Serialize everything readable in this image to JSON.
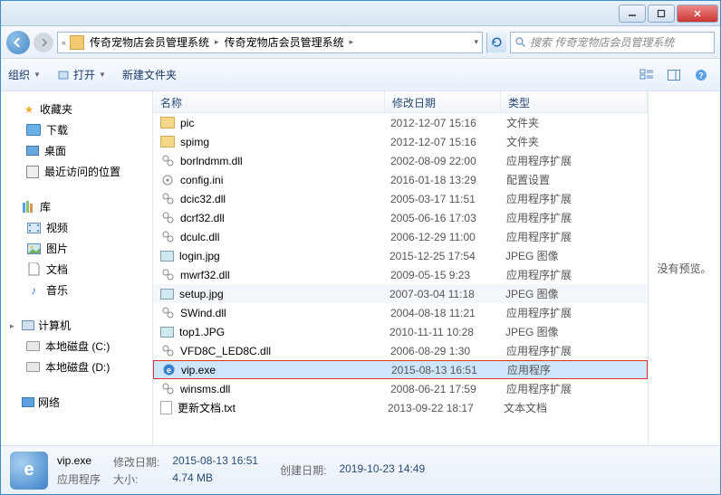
{
  "titlebar": {
    "min": "—",
    "max": "☐",
    "close": "✕"
  },
  "address": {
    "back_chev": "«",
    "seg1": "传奇宠物店会员管理系统",
    "seg2": "传奇宠物店会员管理系统"
  },
  "search": {
    "placeholder": "搜索 传奇宠物店会员管理系统"
  },
  "toolbar": {
    "organize": "组织",
    "open": "打开",
    "new_folder": "新建文件夹"
  },
  "sidebar": {
    "favorites": "收藏夹",
    "downloads": "下载",
    "desktop": "桌面",
    "recent": "最近访问的位置",
    "libraries": "库",
    "videos": "视频",
    "pictures": "图片",
    "documents": "文档",
    "music": "音乐",
    "computer": "计算机",
    "drive_c": "本地磁盘 (C:)",
    "drive_d": "本地磁盘 (D:)",
    "network": "网络"
  },
  "columns": {
    "name": "名称",
    "date": "修改日期",
    "type": "类型"
  },
  "files": [
    {
      "name": "pic",
      "date": "2012-12-07 15:16",
      "type": "文件夹",
      "icon": "folder"
    },
    {
      "name": "spimg",
      "date": "2012-12-07 15:16",
      "type": "文件夹",
      "icon": "folder"
    },
    {
      "name": "borlndmm.dll",
      "date": "2002-08-09 22:00",
      "type": "应用程序扩展",
      "icon": "dll"
    },
    {
      "name": "config.ini",
      "date": "2016-01-18 13:29",
      "type": "配置设置",
      "icon": "ini"
    },
    {
      "name": "dcic32.dll",
      "date": "2005-03-17 11:51",
      "type": "应用程序扩展",
      "icon": "dll"
    },
    {
      "name": "dcrf32.dll",
      "date": "2005-06-16 17:03",
      "type": "应用程序扩展",
      "icon": "dll"
    },
    {
      "name": "dculc.dll",
      "date": "2006-12-29 11:00",
      "type": "应用程序扩展",
      "icon": "dll"
    },
    {
      "name": "login.jpg",
      "date": "2015-12-25 17:54",
      "type": "JPEG 图像",
      "icon": "jpg"
    },
    {
      "name": "mwrf32.dll",
      "date": "2009-05-15 9:23",
      "type": "应用程序扩展",
      "icon": "dll"
    },
    {
      "name": "setup.jpg",
      "date": "2007-03-04 11:18",
      "type": "JPEG 图像",
      "icon": "jpg",
      "alt": true
    },
    {
      "name": "SWind.dll",
      "date": "2004-08-18 11:21",
      "type": "应用程序扩展",
      "icon": "dll"
    },
    {
      "name": "top1.JPG",
      "date": "2010-11-11 10:28",
      "type": "JPEG 图像",
      "icon": "jpg"
    },
    {
      "name": "VFD8C_LED8C.dll",
      "date": "2006-08-29 1:30",
      "type": "应用程序扩展",
      "icon": "dll"
    },
    {
      "name": "vip.exe",
      "date": "2015-08-13 16:51",
      "type": "应用程序",
      "icon": "exe",
      "selected": true,
      "highlighted": true
    },
    {
      "name": "winsms.dll",
      "date": "2008-06-21 17:59",
      "type": "应用程序扩展",
      "icon": "dll"
    },
    {
      "name": "更新文档.txt",
      "date": "2013-09-22 18:17",
      "type": "文本文档",
      "icon": "txt"
    }
  ],
  "preview": {
    "none": "没有预览。"
  },
  "status": {
    "filename": "vip.exe",
    "filetype": "应用程序",
    "mdate_label": "修改日期:",
    "mdate": "2015-08-13 16:51",
    "cdate_label": "创建日期:",
    "cdate": "2019-10-23 14:49",
    "size_label": "大小:",
    "size": "4.74 MB"
  }
}
